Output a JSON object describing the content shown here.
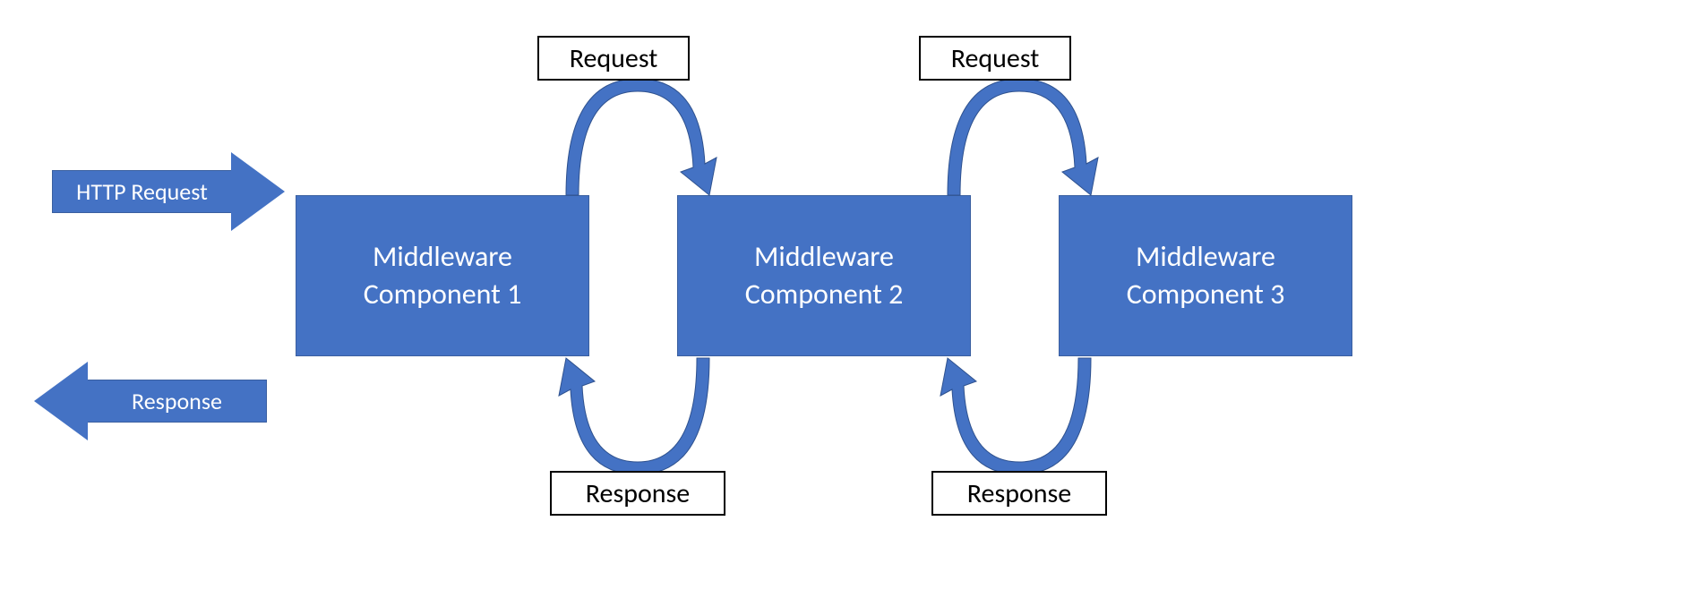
{
  "arrows": {
    "http_request": "HTTP Request",
    "http_response": "Response"
  },
  "labels": {
    "request_1_2": "Request",
    "request_2_3": "Request",
    "response_2_1": "Response",
    "response_3_2": "Response"
  },
  "components": {
    "c1": "Middleware\nComponent 1",
    "c2": "Middleware\nComponent 2",
    "c3": "Middleware\nComponent 3"
  },
  "colors": {
    "fill": "#4472C4",
    "stroke": "#2F528F"
  }
}
